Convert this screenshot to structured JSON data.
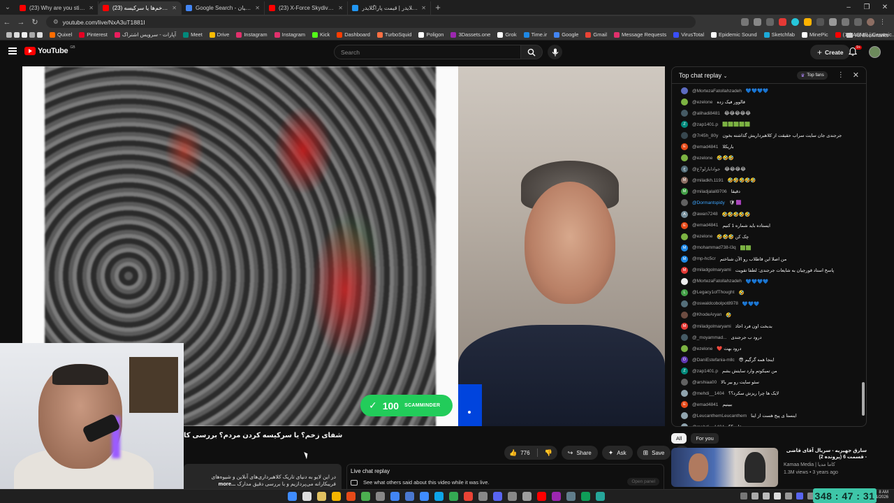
{
  "browser": {
    "tabs": [
      {
        "label": "(23) Why are you still in touch",
        "color": "#ff0000",
        "active": false
      },
      {
        "label": "(23) شفای زخم‌ها یا سرکیسه",
        "color": "#ff0000",
        "active": true
      },
      {
        "label": "Google Search - غزال قورچیان",
        "color": "#4285f4",
        "active": false
      },
      {
        "label": "(23) X-Force Skydiving - Brad H",
        "color": "#ff0000",
        "active": false
      },
      {
        "label": "خرید پاراگلایدر | قیمت پاراگلایدر",
        "color": "#2196f3",
        "active": false
      }
    ],
    "new_tab_symbol": "+",
    "url": "youtube.com/live/NxA3uT1881I",
    "bookmarks": [
      {
        "label": "Quixel",
        "color": "#ff6d00"
      },
      {
        "label": "Pinterest",
        "color": "#e60023"
      },
      {
        "label": "آپارات - سرویس اشتراک",
        "color": "#ea1d5d"
      },
      {
        "label": "Meet",
        "color": "#00897b"
      },
      {
        "label": "Drive",
        "color": "#fbbc04"
      },
      {
        "label": "Instagram",
        "color": "#e1306c"
      },
      {
        "label": "Instagram",
        "color": "#e1306c"
      },
      {
        "label": "Kick",
        "color": "#53fc18"
      },
      {
        "label": "Dashboard",
        "color": "#ff3d00"
      },
      {
        "label": "TurboSquid",
        "color": "#ff7043"
      },
      {
        "label": "Poligon",
        "color": "#ffffff"
      },
      {
        "label": "3Dassets.one",
        "color": "#9c27b0"
      },
      {
        "label": "Grok",
        "color": "#ffffff"
      },
      {
        "label": "Time.ir",
        "color": "#1e88e5"
      },
      {
        "label": "Google",
        "color": "#4285f4"
      },
      {
        "label": "Gmail",
        "color": "#ea4335"
      },
      {
        "label": "Message Requests",
        "color": "#e1306c"
      },
      {
        "label": "VirusTotal",
        "color": "#394eff"
      },
      {
        "label": "Epidemic Sound",
        "color": "#ffffff"
      },
      {
        "label": "Sketchfab",
        "color": "#1caad9"
      },
      {
        "label": "MinePic",
        "color": "#ffffff"
      },
      {
        "label": "(11) ASMR | Ceramic...",
        "color": "#ff0000"
      }
    ],
    "all_bookmarks": "All Bookmarks",
    "window_controls": [
      "–",
      "❐",
      "✕"
    ]
  },
  "youtube": {
    "logo_text": "YouTube",
    "logo_country": "GB",
    "search_placeholder": "Search",
    "create_label": "Create",
    "notification_count": "9+",
    "video": {
      "badge_number": "100",
      "badge_text": "SCAMMINDER",
      "title": "شفای زخم؟ یا سرکیسه کردن مردم؟ بررسی کا",
      "likes": "776",
      "share_label": "Share",
      "ask_label": "Ask",
      "save_label": "Save",
      "description": "در این لایو به دنیای تاریک کلاهبرداری‌های آنلاین و شیوه‌های فریبکارانه می‌پردازیم و با بررسی دقیق مدارک",
      "more_label": "...more"
    },
    "live_replay": {
      "title": "Live chat replay",
      "text": "See what others said about this video while it was live.",
      "button": "Open panel"
    },
    "chat": {
      "title": "Top chat replay",
      "top_fans": "Top fans",
      "messages": [
        {
          "author": "@MortezaFatollahzadeh",
          "text": "💙💙💙💙",
          "color": "#5c6bc0",
          "initial": "",
          "member": false
        },
        {
          "author": "@ezelone",
          "text": "فالوور فیک زده",
          "color": "#7cb342",
          "initial": "",
          "member": false
        },
        {
          "author": "@alihadi8481",
          "text": "😂😂😂😂😂",
          "color": "#455a64",
          "initial": "",
          "member": false
        },
        {
          "author": "@zap1401.p",
          "text": "🟩🟩🟩🟩🟩",
          "color": "#00897b",
          "initial": "Z",
          "member": false
        },
        {
          "author": "@7r45h_80y",
          "text": "جرجندی جان سایت سراب حقیقت از کلاهبرداریش گذاشته بخون",
          "color": "#37474f",
          "initial": "",
          "member": false
        },
        {
          "author": "@emad4841",
          "text": "باریکلا",
          "color": "#e64a19",
          "initial": "E",
          "member": false
        },
        {
          "author": "@ezelone",
          "text": "🤣🤣🤣",
          "color": "#7cb342",
          "initial": "",
          "member": false
        },
        {
          "author": "@جوادابازلو7ع",
          "text": "😂😂😂😂",
          "color": "#546e7a",
          "initial": "ج",
          "member": false
        },
        {
          "author": "@miladkh.1191",
          "text": "🤣🤣🤣🤣🤣",
          "color": "#8d6e63",
          "initial": "M",
          "member": false
        },
        {
          "author": "@miladjalali9706",
          "text": "دقیقا",
          "color": "#43a047",
          "initial": "M",
          "member": false
        },
        {
          "author": "@Dormantspidy",
          "text": "🛡 🟪",
          "color": "#616161",
          "initial": "",
          "member": true
        },
        {
          "author": "@awan7248",
          "text": "🤣🤣🤣🤣🤣",
          "color": "#78909c",
          "initial": "A",
          "member": false
        },
        {
          "author": "@emad4841",
          "text": "ایستاده باید شماره 1 کنیم",
          "color": "#e64a19",
          "initial": "E",
          "member": false
        },
        {
          "author": "@ezelone",
          "text": "🤣🤣🤣 چک کن",
          "color": "#7cb342",
          "initial": "",
          "member": false
        },
        {
          "author": "@mohammad738-l3q",
          "text": "🟩🟩",
          "color": "#1e88e5",
          "initial": "M",
          "member": false
        },
        {
          "author": "@mp-hc5cr",
          "text": "من اصلا این قاطلاب رو الآن شناختم",
          "color": "#1e88e5",
          "initial": "M",
          "member": false
        },
        {
          "author": "@miladgolmaryami",
          "text": "پاسخ استاد قورچیان به شایعات جرجندی: لطفا تقویت",
          "color": "#e53935",
          "initial": "M",
          "member": false
        },
        {
          "author": "@MortezaFatollahzadeh",
          "text": "💙💙💙💙",
          "color": "#eeeeee",
          "initial": "",
          "member": false
        },
        {
          "author": "@Legacy1ofThought",
          "text": "🤣",
          "color": "#43a047",
          "initial": "L",
          "member": false
        },
        {
          "author": "@oswaldcobolpot8978",
          "text": "💙💙💙",
          "color": "#546e7a",
          "initial": "",
          "member": false
        },
        {
          "author": "@KhodeAryan",
          "text": "🤣",
          "color": "#6d4c41",
          "initial": "",
          "member": false
        },
        {
          "author": "@miladgolmaryami",
          "text": "بدبخت اون فرد اخاذ",
          "color": "#e53935",
          "initial": "M",
          "member": false
        },
        {
          "author": "@_moyammad...",
          "text": "درود ب جرجندی",
          "color": "#455a64",
          "initial": "",
          "member": false
        },
        {
          "author": "@ezelone",
          "text": "❤️ درود بهت",
          "color": "#7cb342",
          "initial": "",
          "member": false
        },
        {
          "author": "@DaniEstefania-mllc",
          "text": "😎 اینجا همه گرگیم",
          "color": "#5e35b1",
          "initial": "D",
          "member": false
        },
        {
          "author": "@zap1401.p",
          "text": "من تمیکوتم وارد سایتش بشم",
          "color": "#00897b",
          "initial": "Z",
          "member": false
        },
        {
          "author": "@arshiaa00",
          "text": "سئو سایت رو بیر بالا",
          "color": "#616161",
          "initial": "",
          "member": false
        },
        {
          "author": "@mehdi__1404",
          "text": "لایک ها چرا ریزش سکرد؟؟",
          "color": "#90a4ae",
          "initial": "",
          "member": false
        },
        {
          "author": "@emad4841",
          "text": "ببینیم",
          "color": "#e64a19",
          "initial": "E",
          "member": false
        },
        {
          "author": "@LeucanthemLeucanthem",
          "text": "اینستا ی پیج هست از اینا",
          "color": "#90a4ae",
          "initial": "",
          "member": false
        },
        {
          "author": "@mehdi__1404",
          "text": "علت؟؟",
          "color": "#90a4ae",
          "initial": "",
          "member": false
        }
      ]
    },
    "chips": [
      "All",
      "For you"
    ],
    "recommendation": {
      "title": "سارق جهیزیه - سریال آقای قاضی - قسمت 6 (پرونده 2)",
      "channel": "Kamaa Media | کاما مدیا",
      "meta": "1.3M views • 3 years ago"
    }
  },
  "overlay": {
    "timer": "348 : 47 : 31"
  },
  "taskbar": {
    "clock_time": "8 AM",
    "clock_date": "1/1/2026",
    "icons": [
      "#3f8cff",
      "#dddddd",
      "#e0c060",
      "#f3b400",
      "#e64a19",
      "#4caf50",
      "#888888",
      "#4285f4",
      "#4a78d0",
      "#3f8cff",
      "#0ea5e9",
      "#34a853",
      "#ea4335",
      "#888888",
      "#5865f2",
      "#888888",
      "#9e9e9e",
      "#ff0000",
      "#9c27b0",
      "#607d8b",
      "#0f9d58",
      "#26a69a"
    ]
  }
}
